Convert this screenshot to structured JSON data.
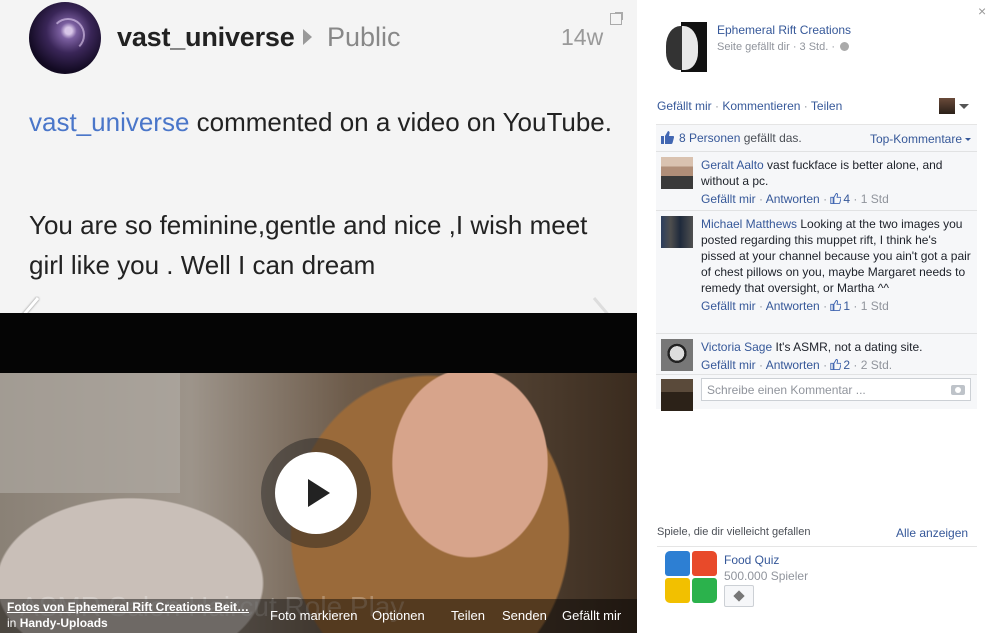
{
  "post": {
    "username": "vast_universe",
    "privacy": "Public",
    "time": "14w",
    "line1_link": "vast_universe",
    "line1_rest": " commented on a video on YouTube.",
    "comment_text": "You are so feminine,gentle and nice ,I wish meet girl like you . Well I can dream",
    "video_overlay_text": "ASMR Salon Haircut Role Play"
  },
  "photo_bar": {
    "album_title": "Fotos von Ephemeral Rift Creations Beit…",
    "album_sub_prefix": "in ",
    "album_sub_name": "Handy-Uploads",
    "actions": [
      "Foto markieren",
      "Optionen",
      "Teilen",
      "Senden",
      "Gefällt mir"
    ]
  },
  "panel": {
    "close": "×",
    "page_name": "Ephemeral Rift Creations",
    "page_meta": "Seite gefällt dir · 3 Std. ·",
    "actions": [
      "Gefällt mir",
      "Kommentieren",
      "Teilen"
    ],
    "likes_count": "8 Personen",
    "likes_rest": " gefällt das.",
    "top_comments": "Top-Kommentare",
    "comments": [
      {
        "author": "Geralt Aalto",
        "text": " vast fuckface is better alone, and without a pc.",
        "like": "Gefällt mir",
        "reply": "Antworten",
        "likes": "4",
        "time": "1 Std"
      },
      {
        "author": "Michael Matthews",
        "text": " Looking at the two images you posted regarding this muppet rift, I think he's pissed at your channel because you ain't got a pair of chest pillows on you, maybe Margaret needs to remedy that oversight, or Martha ^^",
        "like": "Gefällt mir",
        "reply": "Antworten",
        "likes": "1",
        "time": "1 Std"
      },
      {
        "author": "Victoria Sage",
        "text": " It's ASMR, not a dating site.",
        "like": "Gefällt mir",
        "reply": "Antworten",
        "likes": "2",
        "time": "2 Std."
      }
    ],
    "reply_placeholder": "Schreibe einen Kommentar ...",
    "games_title": "Spiele, die dir vielleicht gefallen",
    "games_all": "Alle anzeigen",
    "game_name": "Food Quiz",
    "game_players": "500.000 Spieler"
  },
  "colors": {
    "link": "#365899",
    "post_link": "#4a76c9",
    "meta": "#90949c"
  }
}
